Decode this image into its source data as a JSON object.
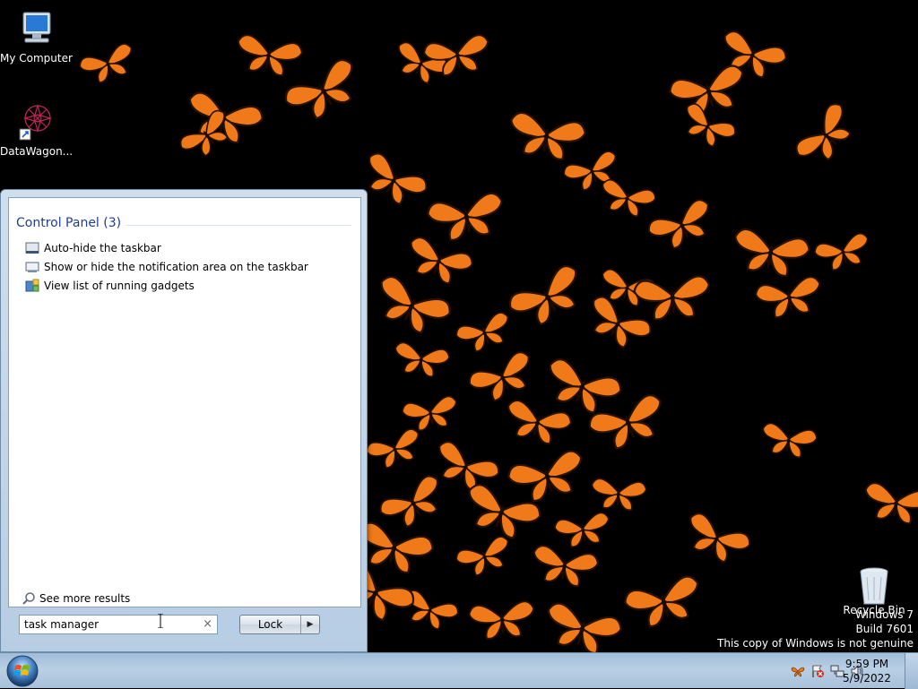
{
  "desktop": {
    "icons": [
      {
        "label": "My Computer"
      },
      {
        "label": "DataWagon..."
      },
      {
        "label": "Recycle Bin"
      }
    ],
    "watermark": {
      "line1": "Windows 7",
      "line2": "Build 7601",
      "line3": "This copy of Windows is not genuine"
    }
  },
  "start_menu": {
    "group_header": "Control Panel (3)",
    "results": [
      {
        "label": "Auto-hide the taskbar",
        "icon": "taskbar-icon"
      },
      {
        "label": "Show or hide the notification area on the taskbar",
        "icon": "notification-area-icon"
      },
      {
        "label": "View list of running gadgets",
        "icon": "gadgets-icon"
      }
    ],
    "see_more": "See more results",
    "search": {
      "value": "task manager",
      "clear": "×"
    },
    "lock_button": "Lock",
    "lock_arrow": "▶"
  },
  "taskbar": {
    "clock": {
      "time": "9:59 PM",
      "date": "5/9/2022"
    },
    "tray_icons": [
      "butterfly-icon",
      "action-center-flag-icon",
      "network-icon",
      "volume-icon"
    ]
  },
  "colors": {
    "accent": "#1e3f8c",
    "butterfly": "#f07a1a",
    "taskbar": "#a8c1da"
  }
}
